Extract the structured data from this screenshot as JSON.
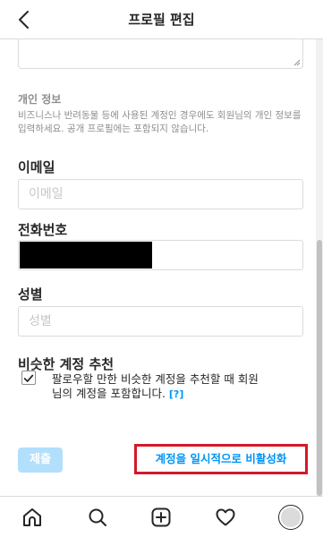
{
  "header": {
    "title": "프로필 편집",
    "back_icon": "chevron-left-icon"
  },
  "personal_info": {
    "heading": "개인 정보",
    "description": "비즈니스나 반려동물 등에 사용된 계정인 경우에도 회원님의 개인 정보를 입력하세요. 공개 프로필에는 포함되지 않습니다."
  },
  "fields": {
    "email": {
      "label": "이메일",
      "placeholder": "이메일",
      "value": ""
    },
    "phone": {
      "label": "전화번호",
      "value_redacted": true
    },
    "gender": {
      "label": "성별",
      "placeholder": "성별",
      "value": ""
    }
  },
  "suggestions": {
    "heading": "비슷한 계정 추천",
    "checkbox_checked": true,
    "checkbox_text": "팔로우할 만한 비슷한 계정을 추천할 때 회원님의 계정을 포함합니다.",
    "help_link": "[?]"
  },
  "actions": {
    "submit_label": "제출",
    "deactivate_label": "계정을 일시적으로 비활성화",
    "highlight_color": "#d3192a",
    "link_color": "#0095f6"
  },
  "bottom_nav": {
    "items": [
      "home-icon",
      "search-icon",
      "new-post-icon",
      "activity-heart-icon",
      "profile-avatar"
    ]
  }
}
